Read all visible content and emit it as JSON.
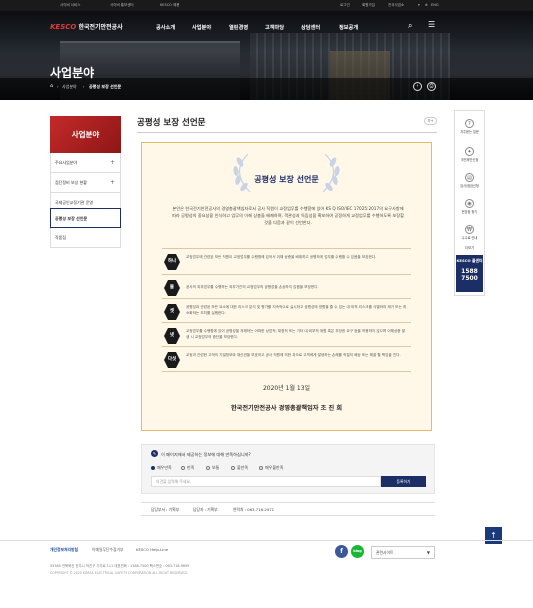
{
  "utility_bar": {
    "left_links": [
      "사이버 서비스",
      "사이버 홍보센터",
      "KESCO 채용"
    ],
    "right_links": [
      "로그인",
      "회원가입",
      "전국사업소"
    ],
    "lang": "ENG"
  },
  "header": {
    "logo_mark": "KESCO",
    "logo_text": "한국전기안전공사",
    "nav": [
      "공사소개",
      "사업분야",
      "열린경영",
      "고객마당",
      "상담센터",
      "정보공개"
    ],
    "section_title": "사업분야"
  },
  "breadcrumb": {
    "items": [
      "사업분야",
      "공평성 보장 선언문"
    ]
  },
  "sidebar": {
    "title": "사업분야",
    "items": [
      {
        "label": "주요사업분야",
        "plus": "+"
      },
      {
        "label": "점단정비 보상 현황",
        "plus": "+"
      },
      {
        "label": "국제공인교정기관 운영",
        "plus": ""
      },
      {
        "label": "공평성 보장 선언문",
        "plus": ""
      },
      {
        "label": "작품집",
        "plus": ""
      }
    ]
  },
  "main": {
    "page_title": "공평성 보장 선언문",
    "size_button": "가+",
    "box_title": "공평성 보장 선언문",
    "intro": "본인은 한국전기안전공사의 경영총괄책임자로서 공사 직원이 교정업무를 수행함에 있어 KS Q ISO/IEC 17025:2017의 요구사항에 따라 공평성의 중요성을 인식하고 업무의 이해 상충을 배제하며, 객관성과 독립성을 확보하여 공정하게 교정업무를 수행하도록 보장할 것을 다음과 같이 선언한다.",
    "rows": [
      {
        "num": "하나",
        "text": "교정업무에 관련된 모든 직원이 교정업무를 수행함에 있어서 이해 상충을 배제하고 공평하게 업무를 수행할 수 있음을 보장한다."
      },
      {
        "num": "둘",
        "text": "공사의 외부업무를 수행하는 외부기관의 교정업무의 공평성을 손상하지 않음을 보장한다."
      },
      {
        "num": "셋",
        "text": "공평성과 관련된 모든 요소에 대한 리스크 분석 및 평가를 지속적으로 실시하고 공평성에 영향을 줄 수 있는 내·외적 리스크를 식별하여 제거 또는 최소화하는 조치를 실행한다."
      },
      {
        "num": "넷",
        "text": "교정업무를 수행함에 있어 공평성을 저해하는 어떠한 상업적, 재정적 또는 기타 내·외부적 위협 혹은 부당한 요구 등을 허용하지 않으며 이해상충 발생 시 교정업무의 중단을 보장한다."
      },
      {
        "num": "다섯",
        "text": "교정과 관련한 고객의 기밀정보와 재산권을 보호하고 공사 직원에 의한 과오로 고객에게 발생하는 손해를 적절히 배상 또는 해결 할 책임을 진다."
      }
    ],
    "date": "2020년 1월 13일",
    "signature": "한국전기안전공사 경영총괄책임자 조 진 희"
  },
  "survey": {
    "question": "이 페이지에서 제공하는 정보에 대해 만족하십니까?",
    "options": [
      "매우만족",
      "만족",
      "보통",
      "불만족",
      "매우불만족"
    ],
    "selected_index": 0,
    "input_placeholder": "의견을 입력해 주세요.",
    "submit": "등록하기"
  },
  "manager": {
    "dept": "담당부서 : 기획부",
    "person": "담당자 : 기획부",
    "phone": "연락처 : 063-716-2071"
  },
  "quick_menu": {
    "items": [
      "자주묻는 질문",
      "국민제안신청",
      "검사/점검신청",
      "현장점 찾기",
      "수수료 안내"
    ],
    "more": "더보기",
    "call_title": "KESCO 콜센터",
    "call_number_1": "1588",
    "call_number_2": "7500"
  },
  "footer": {
    "links": [
      "개인정보처리방침",
      "이메일무단수집거부",
      "KESCO Help-Line"
    ],
    "related_label": "관련사이트",
    "blog_label": "blog",
    "facebook_label": "f",
    "address": "55365 전북혁신 전주시 덕진구 기지로 111   대표전화 : 1588-7500   팩스번호 : 063-716-9699",
    "copyright": "COPYRIGHT © 2020 KOREA ELECTRICAL SAFETY CORPORATION ALL RIGHT RESERVED."
  },
  "colors": {
    "brand_navy": "#1c2e66",
    "brand_red": "#c42a2a",
    "box_border": "#e8b86a"
  }
}
